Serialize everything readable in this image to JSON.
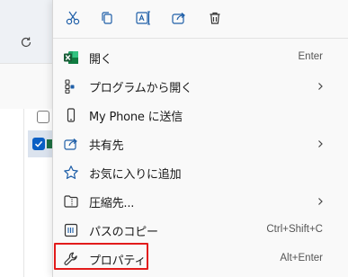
{
  "toolbar": {
    "items": [
      {
        "name": "cut",
        "icon": "scissors-icon"
      },
      {
        "name": "copy",
        "icon": "copy-icon"
      },
      {
        "name": "rename",
        "icon": "rename-icon"
      },
      {
        "name": "share",
        "icon": "share-icon"
      },
      {
        "name": "delete",
        "icon": "trash-icon"
      }
    ]
  },
  "menu": {
    "items": [
      {
        "label": "開く",
        "shortcut": "Enter",
        "icon": "excel-icon",
        "submenu": false
      },
      {
        "label": "プログラムから開く",
        "shortcut": "",
        "icon": "open-with-icon",
        "submenu": true
      },
      {
        "label": "My Phone に送信",
        "shortcut": "",
        "icon": "phone-icon",
        "submenu": false
      },
      {
        "label": "共有先",
        "shortcut": "",
        "icon": "share-icon",
        "submenu": true
      },
      {
        "label": "お気に入りに追加",
        "shortcut": "",
        "icon": "star-icon",
        "submenu": false
      },
      {
        "label": "圧縮先...",
        "shortcut": "",
        "icon": "zip-folder-icon",
        "submenu": true
      },
      {
        "label": "パスのコピー",
        "shortcut": "Ctrl+Shift+C",
        "icon": "copy-path-icon",
        "submenu": false
      },
      {
        "label": "プロパティ",
        "shortcut": "Alt+Enter",
        "icon": "wrench-icon",
        "submenu": false,
        "highlighted": true
      }
    ]
  },
  "background": {
    "icons": [
      "refresh-icon",
      "scissors-icon",
      "copy-icon"
    ]
  },
  "colors": {
    "accent": "#0a5fc4",
    "excel_green": "#1d6f42",
    "highlight_red": "#e21b1b",
    "icon_blue": "#1f5fa8"
  }
}
